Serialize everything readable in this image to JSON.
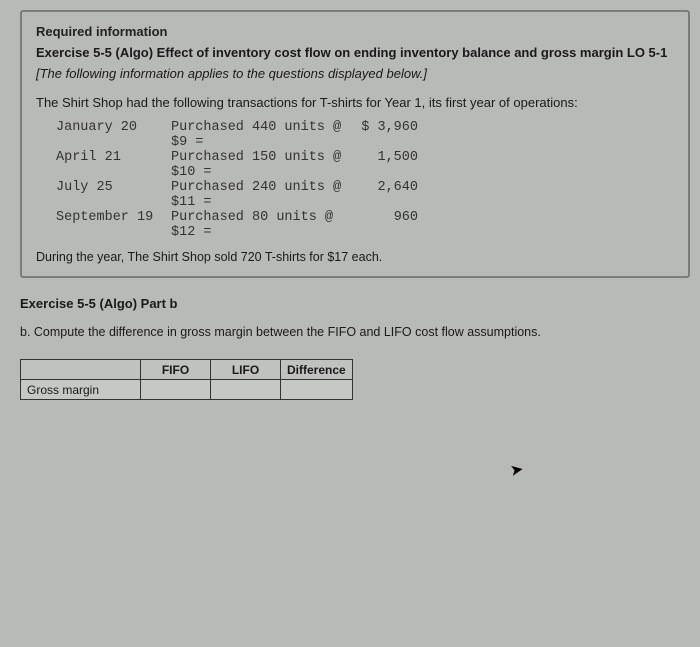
{
  "required_info": "Required information",
  "exercise_title": "Exercise 5-5 (Algo) Effect of inventory cost flow on ending inventory balance and gross margin LO 5-1",
  "instruction_italic": "[The following information applies to the questions displayed below.]",
  "transactions_intro": "The Shirt Shop had the following transactions for T-shirts for Year 1, its first year of operations:",
  "transactions": [
    {
      "date": "January 20",
      "line1": "Purchased 440 units @",
      "line2": "$9 =",
      "amount": "$ 3,960"
    },
    {
      "date": "April 21",
      "line1": "Purchased 150 units @",
      "line2": "$10 =",
      "amount": "1,500"
    },
    {
      "date": "July 25",
      "line1": "Purchased 240 units @",
      "line2": "$11 =",
      "amount": "2,640"
    },
    {
      "date": "September 19",
      "line1": "Purchased 80 units @",
      "line2": "$12 =",
      "amount": "960"
    }
  ],
  "sold_note": "During the year, The Shirt Shop sold 720 T-shirts for $17 each.",
  "part_b_title": "Exercise 5-5 (Algo) Part b",
  "part_b_instr": "b. Compute the difference in gross margin between the FIFO and LIFO cost flow assumptions.",
  "table": {
    "headers": {
      "blank": "",
      "fifo": "FIFO",
      "lifo": "LIFO",
      "diff": "Difference"
    },
    "rowlabel": "Gross margin",
    "cells": {
      "fifo": "",
      "lifo": "",
      "diff": ""
    }
  }
}
